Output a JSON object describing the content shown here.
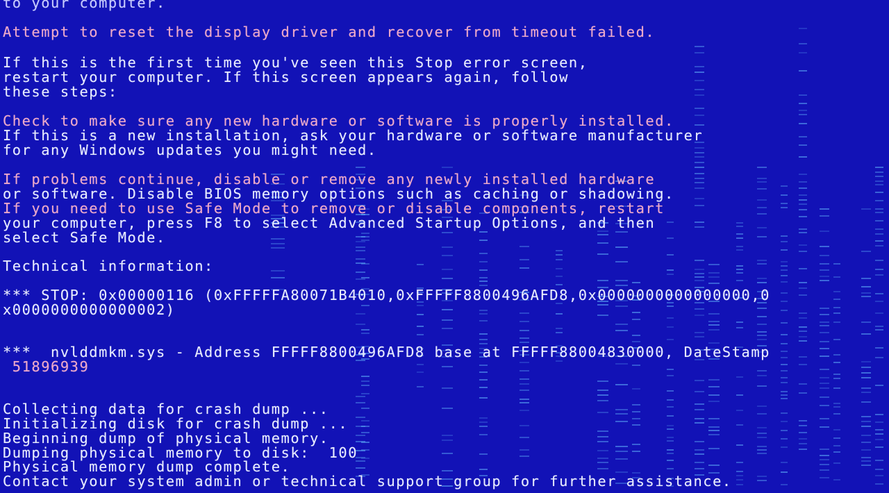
{
  "lines": {
    "l01": "to your computer.",
    "l02": "Attempt to reset the display driver and recover from timeout failed.",
    "l03": "If this is the first time you've seen this Stop error screen,",
    "l04": "restart your computer. If this screen appears again, follow",
    "l05": "these steps:",
    "l06": "Check to make sure any new hardware or software is properly installed.",
    "l07": "If this is a new installation, ask your hardware or software manufacturer",
    "l08": "for any Windows updates you might need.",
    "l09": "If problems continue, disable or remove any newly installed hardware",
    "l10": "or software. Disable BIOS memory options such as caching or shadowing.",
    "l11": "If you need to use Safe Mode to remove or disable components, restart",
    "l12": "your computer, press F8 to select Advanced Startup Options, and then",
    "l13": "select Safe Mode.",
    "l14": "Technical information:",
    "l15": "*** STOP: 0x00000116 (0xFFFFFA80071B4010,0xFFFFF8800496AFD8,0x0000000000000000,0",
    "l16": "x0000000000000002)",
    "l17": "***  nvlddmkm.sys - Address FFFFF8800496AFD8 base at FFFFF88004830000, DateStamp",
    "l18": " 51896939",
    "l19": "Collecting data for crash dump ...",
    "l20": "Initializing disk for crash dump ...",
    "l21": "Beginning dump of physical memory.",
    "l22": "Dumping physical memory to disk:  100",
    "l23": "Physical memory dump complete.",
    "l24": "Contact your system admin or technical support group for further assistance."
  },
  "colors": {
    "background": "#1212b6",
    "text": "#e8ecff",
    "glitch_stripes": "#66beff"
  }
}
